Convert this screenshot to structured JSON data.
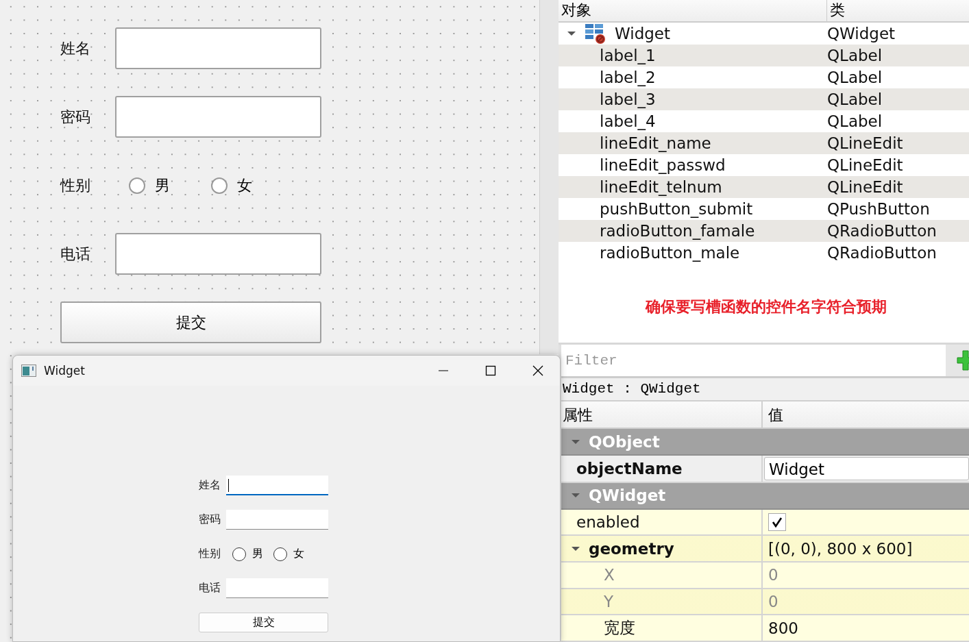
{
  "designer_form": {
    "fields": [
      {
        "kind": "text",
        "label": "姓名"
      },
      {
        "kind": "text",
        "label": "密码"
      },
      {
        "kind": "radio",
        "label": "性别",
        "options": [
          {
            "label": "男",
            "selected": false
          },
          {
            "label": "女",
            "selected": false
          }
        ]
      },
      {
        "kind": "text",
        "label": "电话"
      }
    ],
    "button": "提交"
  },
  "preview_window": {
    "title": "Widget",
    "fields": [
      {
        "kind": "text",
        "label": "姓名",
        "focused": true
      },
      {
        "kind": "text",
        "label": "密码",
        "focused": false
      },
      {
        "kind": "radio",
        "label": "性别",
        "options": [
          {
            "label": "男",
            "selected": false
          },
          {
            "label": "女",
            "selected": false
          }
        ]
      },
      {
        "kind": "text",
        "label": "电话",
        "focused": false
      }
    ],
    "button": "提交"
  },
  "object_inspector": {
    "columns": [
      "对象",
      "类"
    ],
    "tree": [
      {
        "name": "Widget",
        "class": "QWidget",
        "expanded": true,
        "children": [
          {
            "name": "label_1",
            "class": "QLabel"
          },
          {
            "name": "label_2",
            "class": "QLabel"
          },
          {
            "name": "label_3",
            "class": "QLabel"
          },
          {
            "name": "label_4",
            "class": "QLabel"
          },
          {
            "name": "lineEdit_name",
            "class": "QLineEdit"
          },
          {
            "name": "lineEdit_passwd",
            "class": "QLineEdit"
          },
          {
            "name": "lineEdit_telnum",
            "class": "QLineEdit"
          },
          {
            "name": "pushButton_submit",
            "class": "QPushButton"
          },
          {
            "name": "radioButton_famale",
            "class": "QRadioButton"
          },
          {
            "name": "radioButton_male",
            "class": "QRadioButton"
          }
        ]
      }
    ],
    "note": "确保要写槽函数的控件名字符合预期"
  },
  "property_editor": {
    "filter_placeholder": "Filter",
    "context": "Widget : QWidget",
    "columns": [
      "属性",
      "值"
    ],
    "groups": [
      {
        "name": "QObject",
        "expanded": true,
        "color": "#efefef",
        "properties": [
          {
            "kind": "string",
            "name": "objectName",
            "value": "Widget",
            "modified": true,
            "disabled": false
          }
        ]
      },
      {
        "name": "QWidget",
        "expanded": true,
        "color": "#fffee0",
        "properties": [
          {
            "kind": "bool",
            "name": "enabled",
            "checked": true,
            "modified": false,
            "disabled": false
          },
          {
            "kind": "rect",
            "name": "geometry",
            "value": "[(0, 0), 800 x 600]",
            "modified": true,
            "disabled": false,
            "expanded": true,
            "children": [
              {
                "kind": "int",
                "name": "X",
                "value": "0",
                "modified": false,
                "disabled": true
              },
              {
                "kind": "int",
                "name": "Y",
                "value": "0",
                "modified": false,
                "disabled": true
              },
              {
                "kind": "int",
                "name": "宽度",
                "value": "800",
                "modified": false,
                "disabled": false
              }
            ]
          }
        ]
      }
    ]
  }
}
